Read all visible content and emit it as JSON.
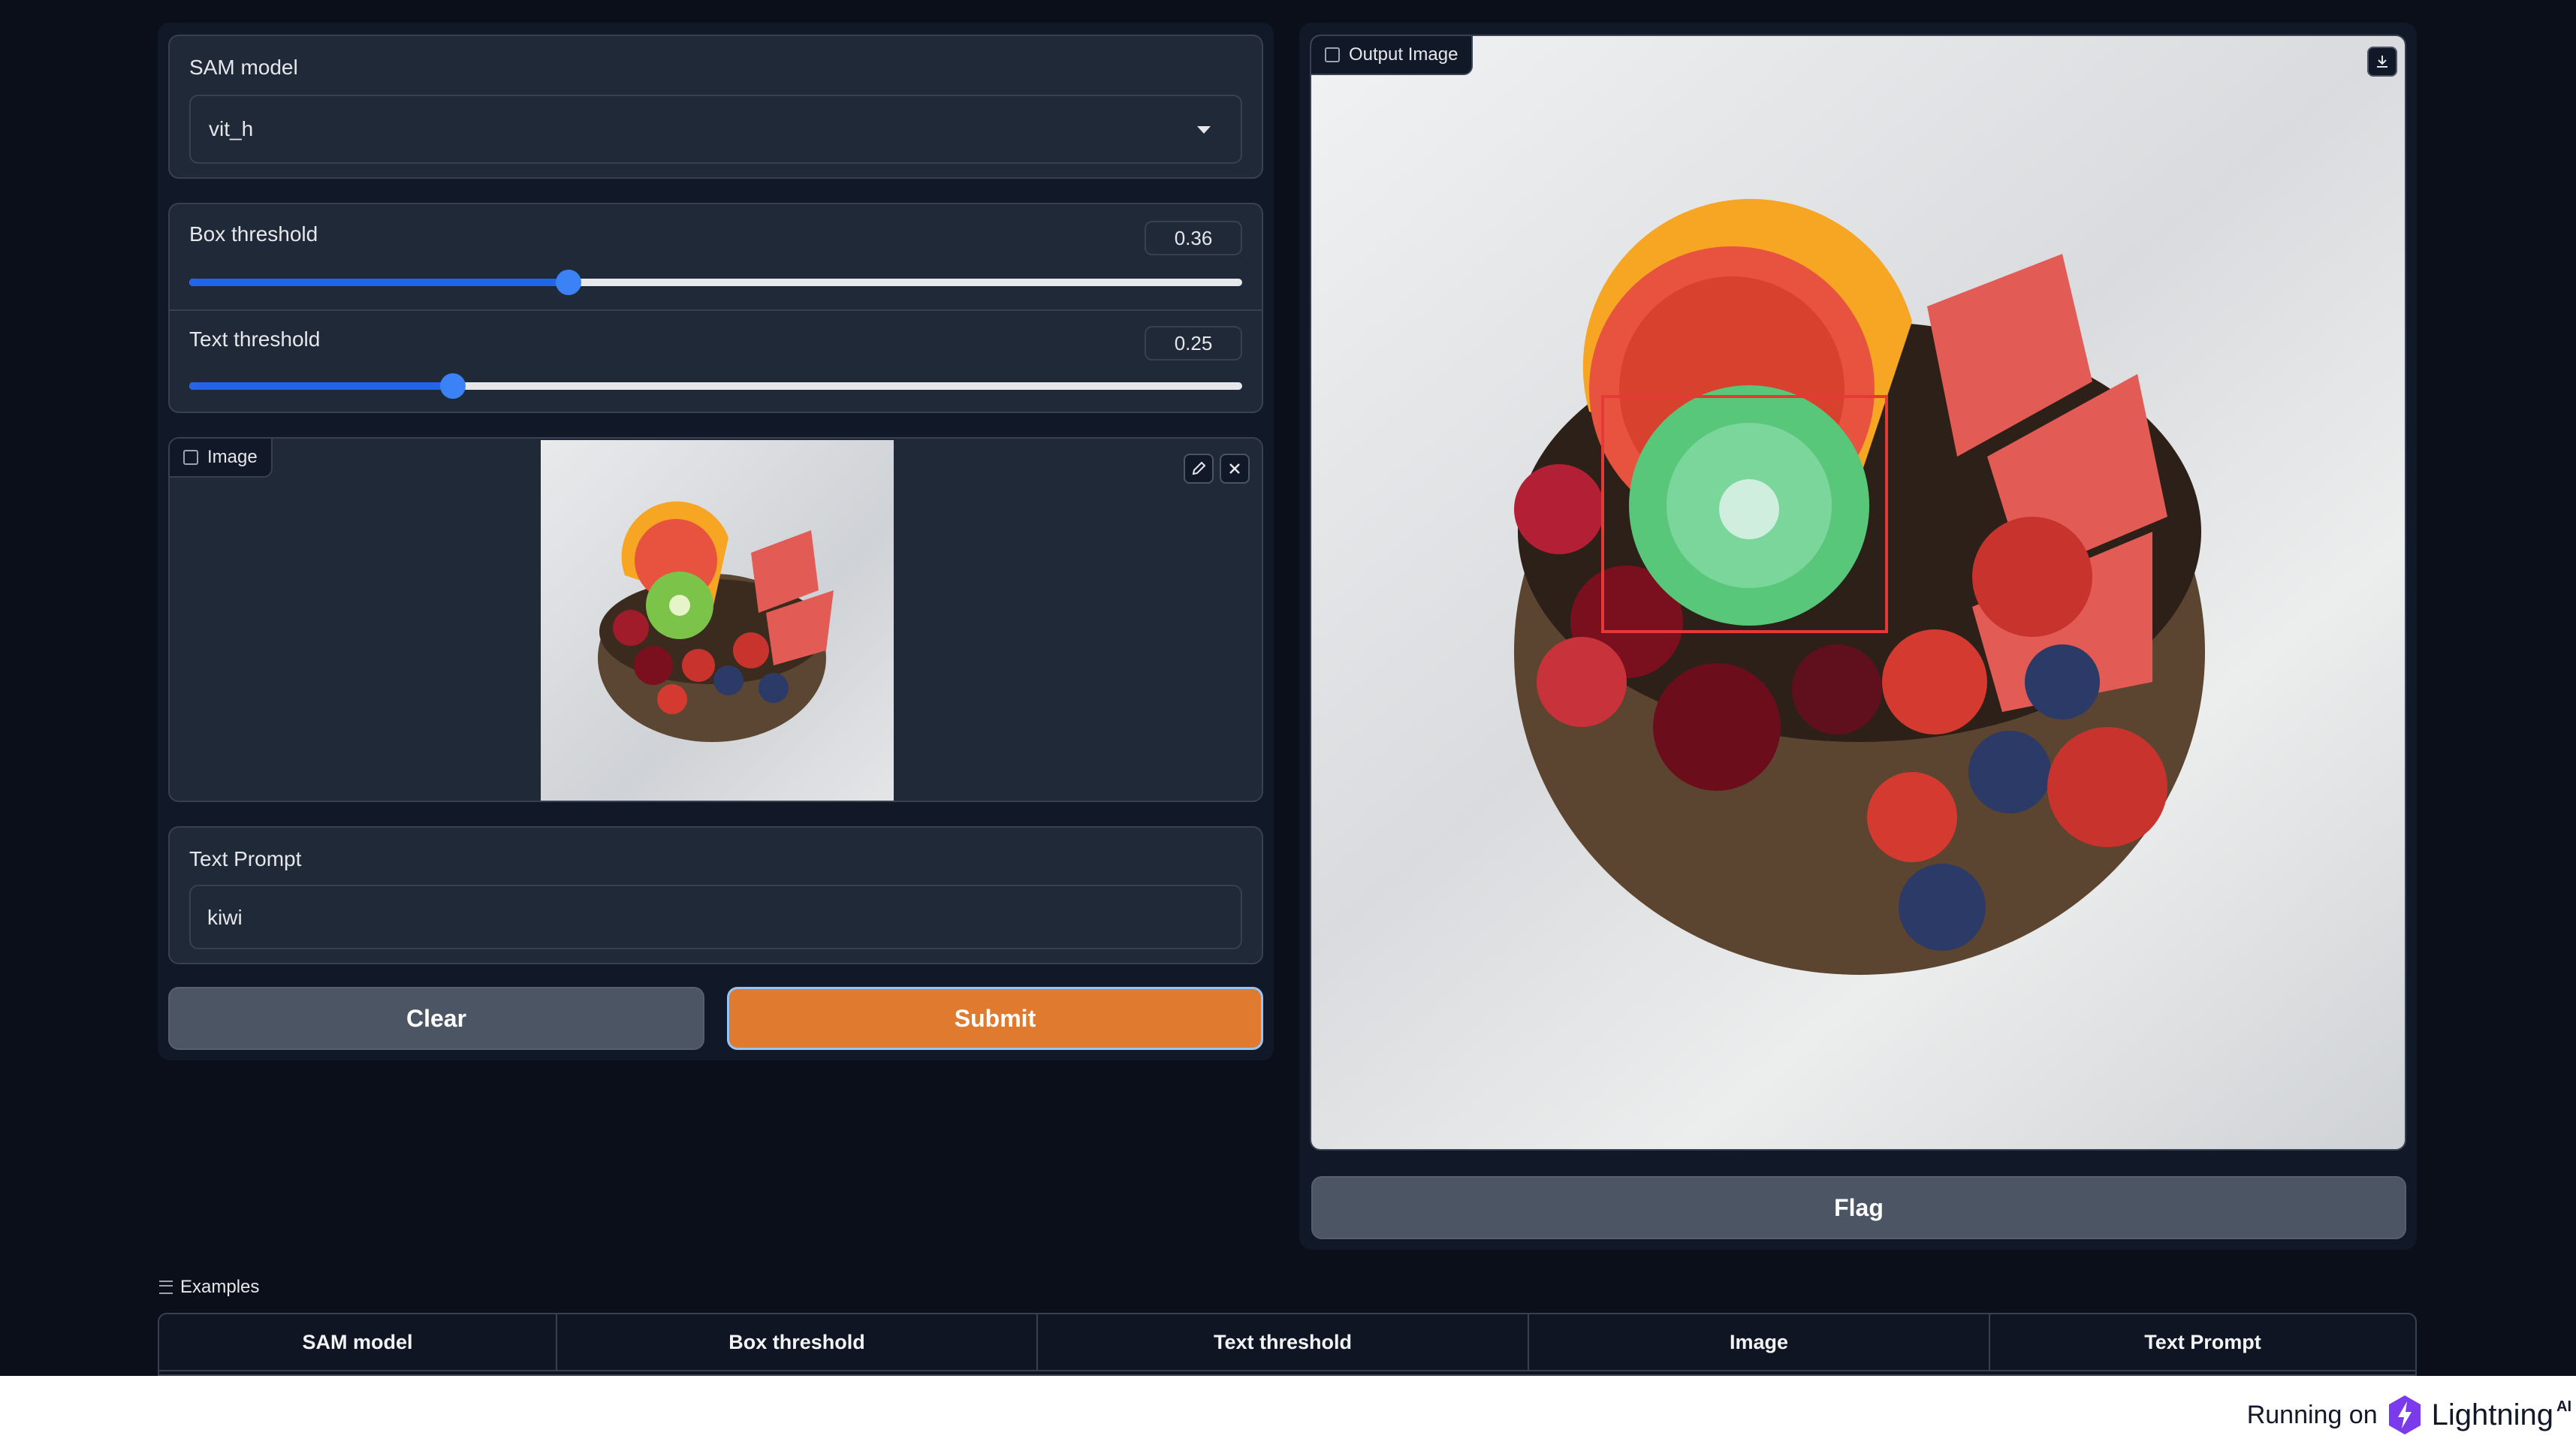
{
  "controls": {
    "sam_model": {
      "label": "SAM model",
      "value": "vit_h"
    },
    "box_threshold": {
      "label": "Box threshold",
      "value": "0.36",
      "level": 0.36
    },
    "text_threshold": {
      "label": "Text threshold",
      "value": "0.25",
      "level": 0.25
    },
    "image": {
      "label": "Image"
    },
    "text_prompt": {
      "label": "Text Prompt",
      "value": "kiwi"
    },
    "clear_label": "Clear",
    "submit_label": "Submit"
  },
  "output": {
    "label": "Output Image",
    "flag_label": "Flag"
  },
  "examples": {
    "label": "Examples",
    "headers": [
      "SAM model",
      "Box threshold",
      "Text threshold",
      "Image",
      "Text Prompt"
    ]
  },
  "footer": {
    "running_on": "Running on",
    "brand": "Lightning",
    "brand_suffix": "AI"
  },
  "colors": {
    "background": "#0b0f19",
    "panel": "#1f2937",
    "slider_accent": "#3b82f6",
    "submit": "#e07a2e",
    "clear": "#4b5563",
    "detection_box": "#e53935",
    "brand": "#7c3aed"
  }
}
